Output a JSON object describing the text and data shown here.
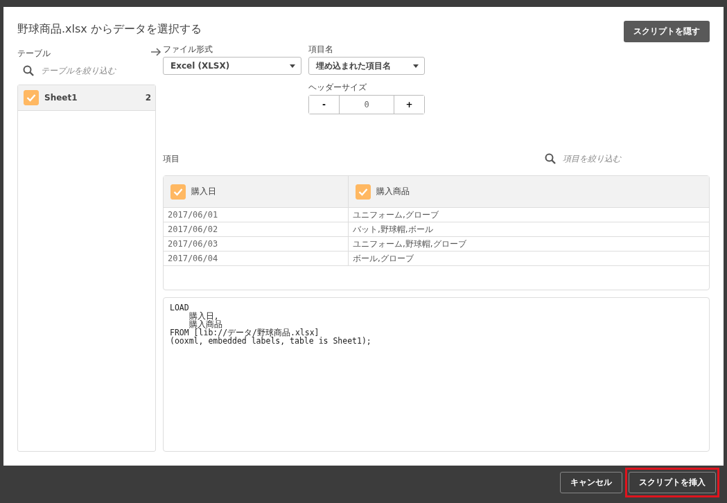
{
  "dialog": {
    "title": "野球商品.xlsx からデータを選択する",
    "hide_script_button": "スクリプトを隠す"
  },
  "tables": {
    "label": "テーブル",
    "filter_placeholder": "テーブルを絞り込む",
    "items": [
      {
        "name": "Sheet1",
        "count": "2",
        "checked": true,
        "selected": true
      }
    ]
  },
  "file_format": {
    "label": "ファイル形式",
    "value": "Excel (XLSX)"
  },
  "field_names": {
    "label": "項目名",
    "value": "埋め込まれた項目名"
  },
  "header_size": {
    "label": "ヘッダーサイズ",
    "minus": "-",
    "value": "0",
    "plus": "+"
  },
  "fields": {
    "label": "項目",
    "filter_placeholder": "項目を絞り込む",
    "columns": [
      {
        "name": "購入日",
        "checked": true
      },
      {
        "name": "購入商品",
        "checked": true
      }
    ],
    "rows": [
      [
        "2017/06/01",
        "ユニフォーム,グローブ"
      ],
      [
        "2017/06/02",
        "バット,野球帽,ボール"
      ],
      [
        "2017/06/03",
        "ユニフォーム,野球帽,グローブ"
      ],
      [
        "2017/06/04",
        "ボール,グローブ"
      ]
    ]
  },
  "script_lines": [
    "LOAD",
    "    購入日,",
    "    購入商品",
    "FROM [lib://データ/野球商品.xlsx]",
    "(ooxml, embedded labels, table is Sheet1);"
  ],
  "footer": {
    "buttons": [
      {
        "label": "キャンセル",
        "highlighted": false
      },
      {
        "label": "スクリプトを挿入",
        "highlighted": true
      }
    ]
  }
}
